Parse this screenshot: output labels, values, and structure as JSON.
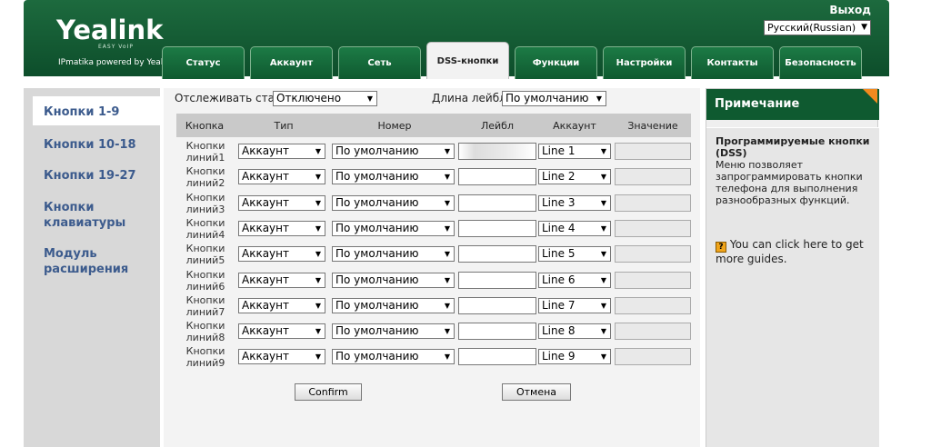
{
  "header": {
    "brand": "Yealink",
    "brand_sub": "EASY VoIP",
    "powered_by": "IPmatika powered by Yealink",
    "logout": "Выход",
    "language": "Русский(Russian)"
  },
  "tabs": [
    {
      "label": "Статус"
    },
    {
      "label": "Аккаунт"
    },
    {
      "label": "Сеть"
    },
    {
      "label": "DSS-кнопки",
      "active": true
    },
    {
      "label": "Функции"
    },
    {
      "label": "Настройки"
    },
    {
      "label": "Контакты"
    },
    {
      "label": "Безопасность"
    }
  ],
  "sidebar": {
    "items": [
      {
        "label": "Кнопки 1-9",
        "active": true
      },
      {
        "label": "Кнопки 10-18"
      },
      {
        "label": "Кнопки 19-27"
      },
      {
        "label": "Кнопки клавиатуры"
      },
      {
        "label": "Модуль расширения"
      }
    ]
  },
  "filters": {
    "track_status_label": "Отслеживать статус",
    "track_status_value": "Отключено",
    "label_length_label": "Длина лейбла",
    "label_length_value": "По умолчанию"
  },
  "table": {
    "headers": [
      "Кнопка",
      "Тип",
      "Номер",
      "Лейбл",
      "Аккаунт",
      "Значение"
    ],
    "rows": [
      {
        "key": "Кнопки линий1",
        "type": "Аккаунт",
        "number": "По умолчанию",
        "label": "",
        "account": "Line 1",
        "value": ""
      },
      {
        "key": "Кнопки линий2",
        "type": "Аккаунт",
        "number": "По умолчанию",
        "label": "",
        "account": "Line 2",
        "value": ""
      },
      {
        "key": "Кнопки линий3",
        "type": "Аккаунт",
        "number": "По умолчанию",
        "label": "",
        "account": "Line 3",
        "value": ""
      },
      {
        "key": "Кнопки линий4",
        "type": "Аккаунт",
        "number": "По умолчанию",
        "label": "",
        "account": "Line 4",
        "value": ""
      },
      {
        "key": "Кнопки линий5",
        "type": "Аккаунт",
        "number": "По умолчанию",
        "label": "",
        "account": "Line 5",
        "value": ""
      },
      {
        "key": "Кнопки линий6",
        "type": "Аккаунт",
        "number": "По умолчанию",
        "label": "",
        "account": "Line 6",
        "value": ""
      },
      {
        "key": "Кнопки линий7",
        "type": "Аккаунт",
        "number": "По умолчанию",
        "label": "",
        "account": "Line 7",
        "value": ""
      },
      {
        "key": "Кнопки линий8",
        "type": "Аккаунт",
        "number": "По умолчанию",
        "label": "",
        "account": "Line 8",
        "value": ""
      },
      {
        "key": "Кнопки линий9",
        "type": "Аккаунт",
        "number": "По умолчанию",
        "label": "",
        "account": "Line 9",
        "value": ""
      }
    ]
  },
  "buttons": {
    "confirm": "Confirm",
    "cancel": "Отмена"
  },
  "note": {
    "title": "Примечание",
    "subtitle": "Программируемые кнопки (DSS)",
    "text": "Меню позволяет запрограммировать кнопки телефона для выполнения разнообразных функций.",
    "guide_icon": "question-icon",
    "guide_text": "You can click here to get more guides."
  },
  "colors": {
    "header_green": "#0f5a30",
    "menu_blue": "#3c5b8d",
    "note_orange": "#f28a1e"
  }
}
